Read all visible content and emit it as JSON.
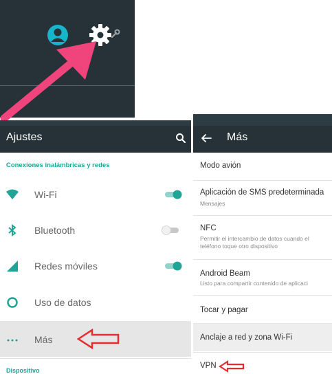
{
  "left": {
    "title": "Ajustes",
    "section_header": "Conexiones inalámbricas y redes",
    "rows": [
      {
        "label": "Wi-Fi",
        "icon": "wifi-icon",
        "toggle": "on"
      },
      {
        "label": "Bluetooth",
        "icon": "bluetooth-icon",
        "toggle": "off"
      },
      {
        "label": "Redes móviles",
        "icon": "signal-icon",
        "toggle": "on"
      },
      {
        "label": "Uso de datos",
        "icon": "data-usage-icon"
      },
      {
        "label": "Más",
        "icon": "more-icon"
      }
    ],
    "bottom_header": "Dispositivo"
  },
  "right": {
    "title": "Más",
    "items": [
      {
        "title": "Modo avión"
      },
      {
        "title": "Aplicación de SMS predeterminada",
        "sub": [
          "Mensajes"
        ]
      },
      {
        "title": "NFC",
        "sub": [
          "Permitir el intercambio de datos cuando el",
          "teléfono toque otro dispositivo"
        ]
      },
      {
        "title": "Android Beam",
        "sub": [
          "Listo para compartir contenido de aplicaci"
        ]
      },
      {
        "title": "Tocar y pagar"
      },
      {
        "title": "Anclaje a red y zona Wi-Fi"
      },
      {
        "title": "VPN"
      }
    ]
  },
  "colors": {
    "toolbar": "#263238",
    "accent": "#1fa495",
    "toggle_on": "#1fa495",
    "annotation_pink": "#f0447c",
    "annotation_red": "#e52d2d"
  }
}
